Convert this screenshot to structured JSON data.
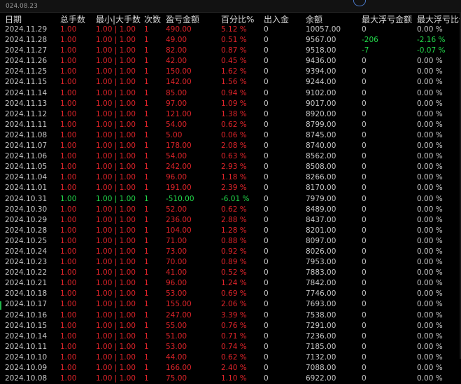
{
  "topbar": {
    "date": "024.08.23"
  },
  "columns": [
    "日期",
    "总手数",
    "最小|大手数",
    "次数",
    "盈亏金额",
    "百分比%",
    "出入金",
    "余额",
    "最大浮亏金额",
    "最大浮亏比例"
  ],
  "rows": [
    {
      "date": "2024.11.29",
      "lots": "1.00",
      "minmax": "1.00 | 1.00",
      "count": "1",
      "pnl": "490.00",
      "pct": "5.12 %",
      "inout": "0",
      "balance": "10057.00",
      "maxdd": "0",
      "maxddpct": "0.00 %",
      "side": "red",
      "dd_side": "grey"
    },
    {
      "date": "2024.11.28",
      "lots": "1.00",
      "minmax": "1.00 | 1.00",
      "count": "1",
      "pnl": "49.00",
      "pct": "0.51 %",
      "inout": "0",
      "balance": "9567.00",
      "maxdd": "-206",
      "maxddpct": "-2.16 %",
      "side": "red",
      "dd_side": "green"
    },
    {
      "date": "2024.11.27",
      "lots": "1.00",
      "minmax": "1.00 | 1.00",
      "count": "1",
      "pnl": "82.00",
      "pct": "0.87 %",
      "inout": "0",
      "balance": "9518.00",
      "maxdd": "-7",
      "maxddpct": "-0.07 %",
      "side": "red",
      "dd_side": "green"
    },
    {
      "date": "2024.11.26",
      "lots": "1.00",
      "minmax": "1.00 | 1.00",
      "count": "1",
      "pnl": "42.00",
      "pct": "0.45 %",
      "inout": "0",
      "balance": "9436.00",
      "maxdd": "0",
      "maxddpct": "0.00 %",
      "side": "red",
      "dd_side": "grey"
    },
    {
      "date": "2024.11.25",
      "lots": "1.00",
      "minmax": "1.00 | 1.00",
      "count": "1",
      "pnl": "150.00",
      "pct": "1.62 %",
      "inout": "0",
      "balance": "9394.00",
      "maxdd": "0",
      "maxddpct": "0.00 %",
      "side": "red",
      "dd_side": "grey"
    },
    {
      "date": "2024.11.15",
      "lots": "1.00",
      "minmax": "1.00 | 1.00",
      "count": "1",
      "pnl": "142.00",
      "pct": "1.56 %",
      "inout": "0",
      "balance": "9244.00",
      "maxdd": "0",
      "maxddpct": "0.00 %",
      "side": "red",
      "dd_side": "grey"
    },
    {
      "date": "2024.11.14",
      "lots": "1.00",
      "minmax": "1.00 | 1.00",
      "count": "1",
      "pnl": "85.00",
      "pct": "0.94 %",
      "inout": "0",
      "balance": "9102.00",
      "maxdd": "0",
      "maxddpct": "0.00 %",
      "side": "red",
      "dd_side": "grey"
    },
    {
      "date": "2024.11.13",
      "lots": "1.00",
      "minmax": "1.00 | 1.00",
      "count": "1",
      "pnl": "97.00",
      "pct": "1.09 %",
      "inout": "0",
      "balance": "9017.00",
      "maxdd": "0",
      "maxddpct": "0.00 %",
      "side": "red",
      "dd_side": "grey"
    },
    {
      "date": "2024.11.12",
      "lots": "1.00",
      "minmax": "1.00 | 1.00",
      "count": "1",
      "pnl": "121.00",
      "pct": "1.38 %",
      "inout": "0",
      "balance": "8920.00",
      "maxdd": "0",
      "maxddpct": "0.00 %",
      "side": "red",
      "dd_side": "grey"
    },
    {
      "date": "2024.11.11",
      "lots": "1.00",
      "minmax": "1.00 | 1.00",
      "count": "1",
      "pnl": "54.00",
      "pct": "0.62 %",
      "inout": "0",
      "balance": "8799.00",
      "maxdd": "0",
      "maxddpct": "0.00 %",
      "side": "red",
      "dd_side": "grey"
    },
    {
      "date": "2024.11.08",
      "lots": "1.00",
      "minmax": "1.00 | 1.00",
      "count": "1",
      "pnl": "5.00",
      "pct": "0.06 %",
      "inout": "0",
      "balance": "8745.00",
      "maxdd": "0",
      "maxddpct": "0.00 %",
      "side": "red",
      "dd_side": "grey"
    },
    {
      "date": "2024.11.07",
      "lots": "1.00",
      "minmax": "1.00 | 1.00",
      "count": "1",
      "pnl": "178.00",
      "pct": "2.08 %",
      "inout": "0",
      "balance": "8740.00",
      "maxdd": "0",
      "maxddpct": "0.00 %",
      "side": "red",
      "dd_side": "grey"
    },
    {
      "date": "2024.11.06",
      "lots": "1.00",
      "minmax": "1.00 | 1.00",
      "count": "1",
      "pnl": "54.00",
      "pct": "0.63 %",
      "inout": "0",
      "balance": "8562.00",
      "maxdd": "0",
      "maxddpct": "0.00 %",
      "side": "red",
      "dd_side": "grey"
    },
    {
      "date": "2024.11.05",
      "lots": "1.00",
      "minmax": "1.00 | 1.00",
      "count": "1",
      "pnl": "242.00",
      "pct": "2.93 %",
      "inout": "0",
      "balance": "8508.00",
      "maxdd": "0",
      "maxddpct": "0.00 %",
      "side": "red",
      "dd_side": "grey"
    },
    {
      "date": "2024.11.04",
      "lots": "1.00",
      "minmax": "1.00 | 1.00",
      "count": "1",
      "pnl": "96.00",
      "pct": "1.18 %",
      "inout": "0",
      "balance": "8266.00",
      "maxdd": "0",
      "maxddpct": "0.00 %",
      "side": "red",
      "dd_side": "grey"
    },
    {
      "date": "2024.11.01",
      "lots": "1.00",
      "minmax": "1.00 | 1.00",
      "count": "1",
      "pnl": "191.00",
      "pct": "2.39 %",
      "inout": "0",
      "balance": "8170.00",
      "maxdd": "0",
      "maxddpct": "0.00 %",
      "side": "red",
      "dd_side": "grey"
    },
    {
      "date": "2024.10.31",
      "lots": "1.00",
      "minmax": "1.00 | 1.00",
      "count": "1",
      "pnl": "-510.00",
      "pct": "-6.01 %",
      "inout": "0",
      "balance": "7979.00",
      "maxdd": "0",
      "maxddpct": "0.00 %",
      "side": "green",
      "dd_side": "grey"
    },
    {
      "date": "2024.10.30",
      "lots": "1.00",
      "minmax": "1.00 | 1.00",
      "count": "1",
      "pnl": "52.00",
      "pct": "0.62 %",
      "inout": "0",
      "balance": "8489.00",
      "maxdd": "0",
      "maxddpct": "0.00 %",
      "side": "red",
      "dd_side": "grey"
    },
    {
      "date": "2024.10.29",
      "lots": "1.00",
      "minmax": "1.00 | 1.00",
      "count": "1",
      "pnl": "236.00",
      "pct": "2.88 %",
      "inout": "0",
      "balance": "8437.00",
      "maxdd": "0",
      "maxddpct": "0.00 %",
      "side": "red",
      "dd_side": "grey"
    },
    {
      "date": "2024.10.28",
      "lots": "1.00",
      "minmax": "1.00 | 1.00",
      "count": "1",
      "pnl": "104.00",
      "pct": "1.28 %",
      "inout": "0",
      "balance": "8201.00",
      "maxdd": "0",
      "maxddpct": "0.00 %",
      "side": "red",
      "dd_side": "grey"
    },
    {
      "date": "2024.10.25",
      "lots": "1.00",
      "minmax": "1.00 | 1.00",
      "count": "1",
      "pnl": "71.00",
      "pct": "0.88 %",
      "inout": "0",
      "balance": "8097.00",
      "maxdd": "0",
      "maxddpct": "0.00 %",
      "side": "red",
      "dd_side": "grey"
    },
    {
      "date": "2024.10.24",
      "lots": "1.00",
      "minmax": "1.00 | 1.00",
      "count": "1",
      "pnl": "73.00",
      "pct": "0.92 %",
      "inout": "0",
      "balance": "8026.00",
      "maxdd": "0",
      "maxddpct": "0.00 %",
      "side": "red",
      "dd_side": "grey"
    },
    {
      "date": "2024.10.23",
      "lots": "1.00",
      "minmax": "1.00 | 1.00",
      "count": "1",
      "pnl": "70.00",
      "pct": "0.89 %",
      "inout": "0",
      "balance": "7953.00",
      "maxdd": "0",
      "maxddpct": "0.00 %",
      "side": "red",
      "dd_side": "grey"
    },
    {
      "date": "2024.10.22",
      "lots": "1.00",
      "minmax": "1.00 | 1.00",
      "count": "1",
      "pnl": "41.00",
      "pct": "0.52 %",
      "inout": "0",
      "balance": "7883.00",
      "maxdd": "0",
      "maxddpct": "0.00 %",
      "side": "red",
      "dd_side": "grey"
    },
    {
      "date": "2024.10.21",
      "lots": "1.00",
      "minmax": "1.00 | 1.00",
      "count": "1",
      "pnl": "96.00",
      "pct": "1.24 %",
      "inout": "0",
      "balance": "7842.00",
      "maxdd": "0",
      "maxddpct": "0.00 %",
      "side": "red",
      "dd_side": "grey"
    },
    {
      "date": "2024.10.18",
      "lots": "1.00",
      "minmax": "1.00 | 1.00",
      "count": "1",
      "pnl": "53.00",
      "pct": "0.69 %",
      "inout": "0",
      "balance": "7746.00",
      "maxdd": "0",
      "maxddpct": "0.00 %",
      "side": "red",
      "dd_side": "grey"
    },
    {
      "date": "2024.10.17",
      "lots": "1.00",
      "minmax": "1.00 | 1.00",
      "count": "1",
      "pnl": "155.00",
      "pct": "2.06 %",
      "inout": "0",
      "balance": "7693.00",
      "maxdd": "0",
      "maxddpct": "0.00 %",
      "side": "red",
      "dd_side": "grey"
    },
    {
      "date": "2024.10.16",
      "lots": "1.00",
      "minmax": "1.00 | 1.00",
      "count": "1",
      "pnl": "247.00",
      "pct": "3.39 %",
      "inout": "0",
      "balance": "7538.00",
      "maxdd": "0",
      "maxddpct": "0.00 %",
      "side": "red",
      "dd_side": "grey"
    },
    {
      "date": "2024.10.15",
      "lots": "1.00",
      "minmax": "1.00 | 1.00",
      "count": "1",
      "pnl": "55.00",
      "pct": "0.76 %",
      "inout": "0",
      "balance": "7291.00",
      "maxdd": "0",
      "maxddpct": "0.00 %",
      "side": "red",
      "dd_side": "grey"
    },
    {
      "date": "2024.10.14",
      "lots": "1.00",
      "minmax": "1.00 | 1.00",
      "count": "1",
      "pnl": "51.00",
      "pct": "0.71 %",
      "inout": "0",
      "balance": "7236.00",
      "maxdd": "0",
      "maxddpct": "0.00 %",
      "side": "red",
      "dd_side": "grey"
    },
    {
      "date": "2024.10.11",
      "lots": "1.00",
      "minmax": "1.00 | 1.00",
      "count": "1",
      "pnl": "53.00",
      "pct": "0.74 %",
      "inout": "0",
      "balance": "7185.00",
      "maxdd": "0",
      "maxddpct": "0.00 %",
      "side": "red",
      "dd_side": "grey"
    },
    {
      "date": "2024.10.10",
      "lots": "1.00",
      "minmax": "1.00 | 1.00",
      "count": "1",
      "pnl": "44.00",
      "pct": "0.62 %",
      "inout": "0",
      "balance": "7132.00",
      "maxdd": "0",
      "maxddpct": "0.00 %",
      "side": "red",
      "dd_side": "grey"
    },
    {
      "date": "2024.10.09",
      "lots": "1.00",
      "minmax": "1.00 | 1.00",
      "count": "1",
      "pnl": "166.00",
      "pct": "2.40 %",
      "inout": "0",
      "balance": "7088.00",
      "maxdd": "0",
      "maxddpct": "0.00 %",
      "side": "red",
      "dd_side": "grey"
    },
    {
      "date": "2024.10.08",
      "lots": "1.00",
      "minmax": "1.00 | 1.00",
      "count": "1",
      "pnl": "75.00",
      "pct": "1.10 %",
      "inout": "0",
      "balance": "6922.00",
      "maxdd": "0",
      "maxddpct": "0.00 %",
      "side": "red",
      "dd_side": "grey"
    }
  ]
}
